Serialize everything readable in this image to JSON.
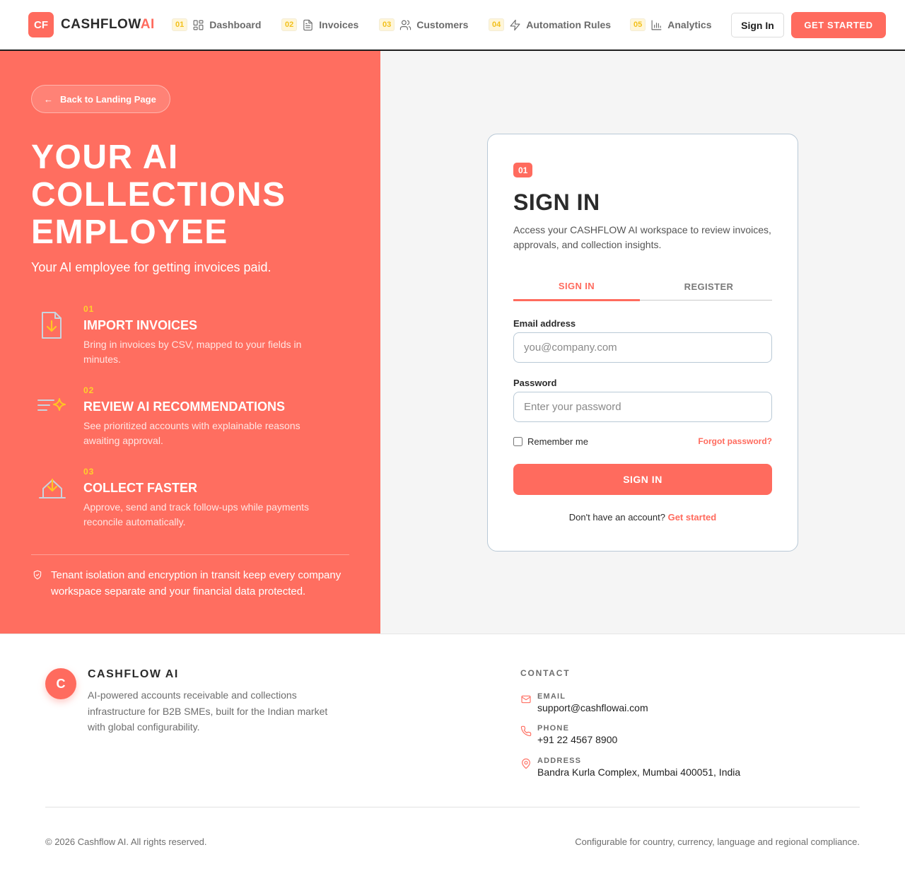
{
  "header": {
    "logo_text": "CF",
    "brand_main": "CASHFLOW",
    "brand_accent": "AI",
    "nav": [
      {
        "num": "01",
        "label": "Dashboard",
        "icon": "dashboard-icon"
      },
      {
        "num": "02",
        "label": "Invoices",
        "icon": "file-icon"
      },
      {
        "num": "03",
        "label": "Customers",
        "icon": "users-icon"
      },
      {
        "num": "04",
        "label": "Automation Rules",
        "icon": "bolt-icon"
      },
      {
        "num": "05",
        "label": "Analytics",
        "icon": "bar-chart-icon"
      }
    ],
    "sign_in_label": "Sign In",
    "get_started_label": "GET STARTED"
  },
  "hero": {
    "back_label": "Back to Landing Page",
    "back_arrow": "←",
    "title": "YOUR AI COLLECTIONS EMPLOYEE",
    "subtitle": "Your AI employee for getting invoices paid.",
    "features": [
      {
        "num": "01",
        "title": "IMPORT INVOICES",
        "desc": "Bring in invoices by CSV, mapped to your fields in minutes.",
        "icon": "file-import-icon"
      },
      {
        "num": "02",
        "title": "REVIEW AI RECOMMENDATIONS",
        "desc": "See prioritized accounts with explainable reasons awaiting approval.",
        "icon": "sparkle-list-icon"
      },
      {
        "num": "03",
        "title": "COLLECT FASTER",
        "desc": "Approve, send and track follow-ups while payments reconcile automatically.",
        "icon": "inbox-download-icon"
      }
    ],
    "security_note": "Tenant isolation and encryption in transit keep every company workspace separate and your financial data protected."
  },
  "card": {
    "badge": "01",
    "title": "SIGN IN",
    "description": "Access your CASHFLOW AI workspace to review invoices, approvals, and collection insights.",
    "tabs": [
      {
        "label": "SIGN IN",
        "active": true
      },
      {
        "label": "REGISTER",
        "active": false
      }
    ],
    "email_label": "Email address",
    "email_placeholder": "you@company.com",
    "password_label": "Password",
    "password_placeholder": "Enter your password",
    "remember_label": "Remember me",
    "forgot_label": "Forgot password?",
    "submit_label": "SIGN IN",
    "no_account_text": "Don't have an account?",
    "get_started_link": "Get started"
  },
  "footer": {
    "avatar_letter": "C",
    "brand": "CASHFLOW AI",
    "description": "AI-powered accounts receivable and collections infrastructure for B2B SMEs, built for the Indian market with global configurability.",
    "contact_heading": "CONTACT",
    "contacts": [
      {
        "label": "EMAIL",
        "value": "support@cashflowai.com",
        "icon": "mail-icon"
      },
      {
        "label": "PHONE",
        "value": "+91 22 4567 8900",
        "icon": "phone-icon"
      },
      {
        "label": "ADDRESS",
        "value": "Bandra Kurla Complex, Mumbai 400051, India",
        "icon": "map-pin-icon"
      }
    ],
    "copyright": "© 2026 Cashflow AI. All rights reserved.",
    "compliance": "Configurable for country, currency, language and regional compliance."
  },
  "colors": {
    "accent": "#ff6b5e",
    "hero_bg": "#ff6e60",
    "highlight": "#ffd12a",
    "panel_bg": "#f5f5f5"
  }
}
